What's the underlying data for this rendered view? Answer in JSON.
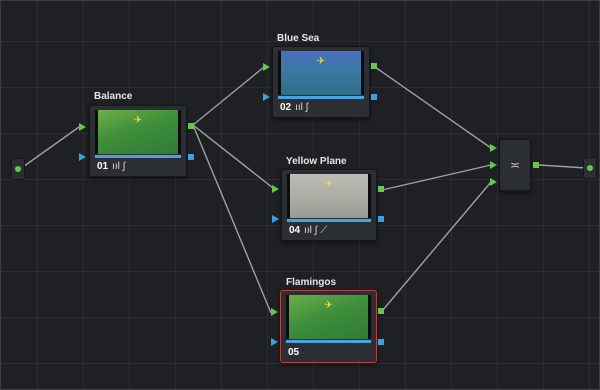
{
  "nodes": {
    "balance": {
      "title": "Balance",
      "number": "01",
      "tools": "ııl ∫"
    },
    "blue_sea": {
      "title": "Blue Sea",
      "number": "02",
      "tools": "ııl ∫"
    },
    "yellow_plane": {
      "title": "Yellow Plane",
      "number": "04",
      "tools": "ııl ∫ ⟋"
    },
    "flamingos": {
      "title": "Flamingos",
      "number": "05",
      "tools": ""
    }
  },
  "mixer": {
    "icon": "layer-mixer-icon",
    "symbol": "≍"
  },
  "thumbnail_icon": "plane-icon",
  "plane_glyph": "✈",
  "colors": {
    "rgb_port": "#64c84a",
    "alpha_port": "#3aa0de",
    "selected_outline": "#b8433f",
    "wire": "#9a9a9a"
  }
}
